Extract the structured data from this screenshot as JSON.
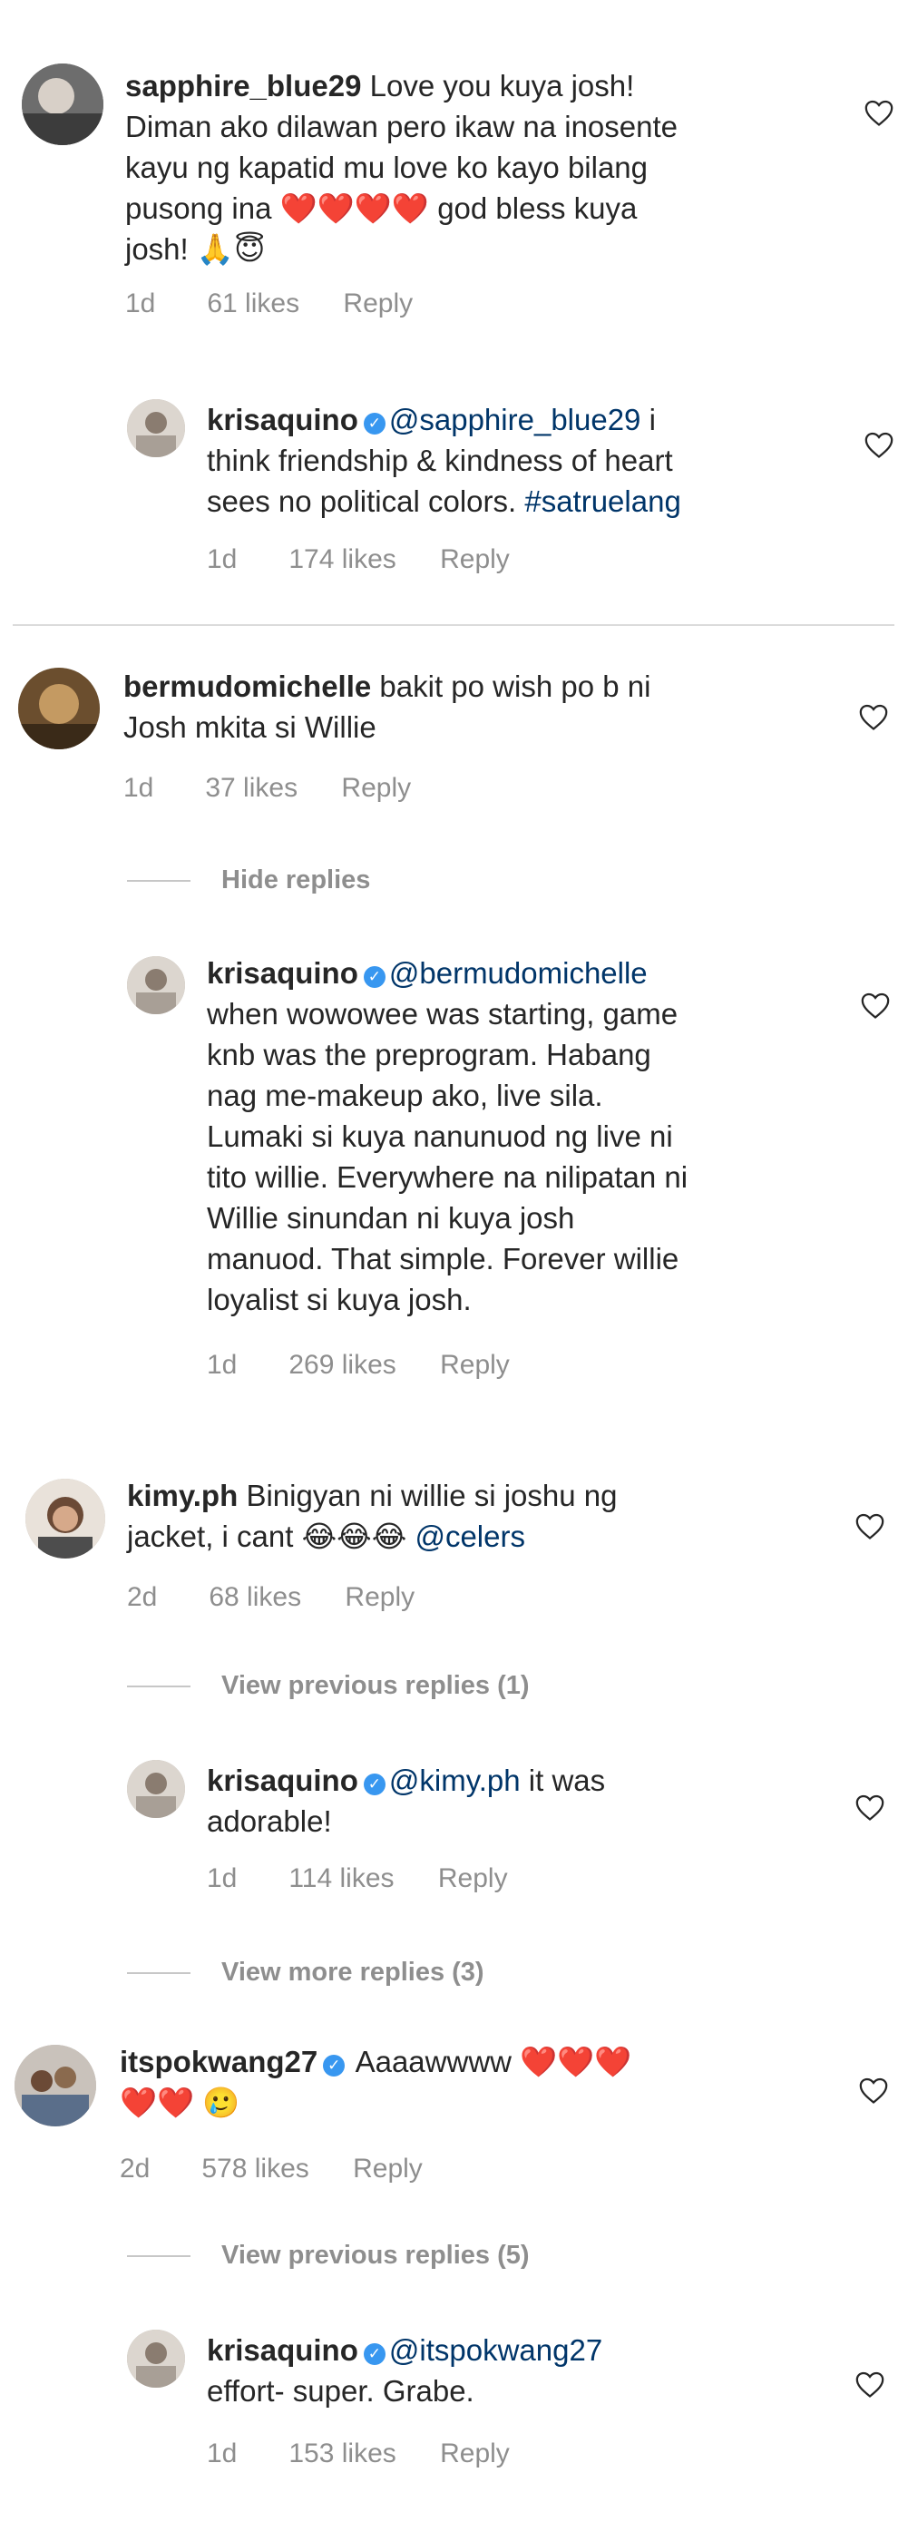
{
  "top_partial_text": "",
  "comments": [
    {
      "username": "sapphire_blue29",
      "text_lines": [
        "Love you kuya josh!",
        "Diman ako dilawan pero ikaw na inosente",
        "kayu ng kapatid mu love ko kayo bilang",
        "pusong ina",
        "god bless kuya",
        "josh!"
      ],
      "emoji_row1": "❤️❤️❤️❤️",
      "emoji_row2": "🙏😇",
      "time": "1d",
      "likes": "61 likes",
      "reply": "Reply"
    },
    {
      "username": "krisaquino",
      "mention": "@sapphire_blue29",
      "text_lines": [
        "i",
        "think friendship & kindness of heart",
        "sees no political colors."
      ],
      "hashtag": "#satruelang",
      "time": "1d",
      "likes": "174 likes",
      "reply": "Reply"
    },
    {
      "username": "bermudomichelle",
      "text_lines": [
        "bakit po wish po b ni",
        "Josh mkita si Willie"
      ],
      "time": "1d",
      "likes": "37 likes",
      "reply": "Reply"
    },
    {
      "toggle": "Hide replies"
    },
    {
      "username": "krisaquino",
      "mention": "@bermudomichelle",
      "text_lines": [
        "when wowowee was starting, game",
        "knb was the preprogram. Habang",
        "nag me-makeup ako, live sila.",
        "Lumaki si kuya nanunuod ng live ni",
        "tito willie. Everywhere na nilipatan ni",
        "Willie sinundan ni kuya josh",
        "manuod. That simple. Forever willie",
        "loyalist si kuya josh."
      ],
      "time": "1d",
      "likes": "269 likes",
      "reply": "Reply"
    },
    {
      "username": "kimy.ph",
      "text_lines": [
        "Binigyan ni willie si joshu ng",
        "jacket, i cant"
      ],
      "emoji_row1": "😂😂😂",
      "mention": "@celers",
      "time": "2d",
      "likes": "68 likes",
      "reply": "Reply"
    },
    {
      "toggle": "View previous replies (1)"
    },
    {
      "username": "krisaquino",
      "mention": "@kimy.ph",
      "text_lines": [
        "it was",
        "adorable!"
      ],
      "time": "1d",
      "likes": "114 likes",
      "reply": "Reply"
    },
    {
      "toggle": "View more replies (3)"
    },
    {
      "username": "itspokwang27",
      "text_lines": [
        "Aaaawwww"
      ],
      "emoji_row1": "❤️❤️❤️",
      "emoji_row2": "❤️❤️ 🥲",
      "time": "2d",
      "likes": "578 likes",
      "reply": "Reply"
    },
    {
      "toggle": "View previous replies (5)"
    },
    {
      "username": "krisaquino",
      "mention": "@itspokwang27",
      "text_lines": [
        "effort- super. Grabe."
      ],
      "time": "1d",
      "likes": "153 likes",
      "reply": "Reply"
    }
  ],
  "icons": {
    "like": "heart-outline-icon",
    "verified": "verified-badge-icon"
  },
  "colors": {
    "text": "#262626",
    "meta": "#8e8e8e",
    "link": "#003569",
    "verified": "#3897f0",
    "divider": "#dbdbdb"
  }
}
